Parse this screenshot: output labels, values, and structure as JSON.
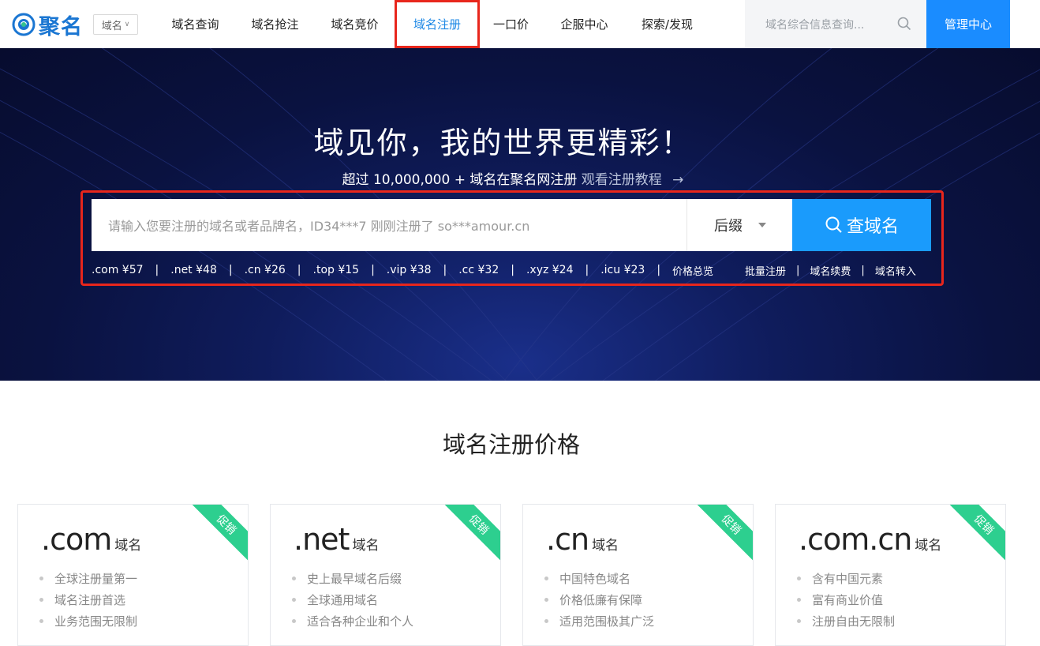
{
  "header": {
    "logo_text": "聚名",
    "category_select": "域名",
    "nav": [
      {
        "label": "域名查询"
      },
      {
        "label": "域名抢注"
      },
      {
        "label": "域名竞价"
      },
      {
        "label": "域名注册"
      },
      {
        "label": "一口价"
      },
      {
        "label": "企服中心"
      },
      {
        "label": "探索/发现"
      }
    ],
    "search_placeholder": "域名综合信息查询...",
    "admin_button": "管理中心",
    "colors": {
      "brand": "#1a76d2",
      "accent": "#1a8cff",
      "highlight": "#e8261c"
    }
  },
  "hero": {
    "title": "域见你，我的世界更精彩！",
    "subtitle_main": "超过 10,000,000 + 域名在聚名网注册",
    "subtitle_link": "观看注册教程",
    "subtitle_arrow": "→",
    "search": {
      "placeholder": "请输入您要注册的域名或者品牌名，ID34***7 刚刚注册了 so***amour.cn",
      "suffix_label": "后缀",
      "button_label": "查域名"
    },
    "prices": [
      {
        "text": ".com ¥57"
      },
      {
        "text": ".net ¥48"
      },
      {
        "text": ".cn ¥26"
      },
      {
        "text": ".top ¥15"
      },
      {
        "text": ".vip ¥38"
      },
      {
        "text": ".cc ¥32"
      },
      {
        "text": ".xyz ¥24"
      },
      {
        "text": ".icu ¥23"
      },
      {
        "text": "价格总览"
      }
    ],
    "right_links": [
      {
        "text": "批量注册"
      },
      {
        "text": "域名续费"
      },
      {
        "text": "域名转入"
      }
    ]
  },
  "pricing": {
    "title": "域名注册价格",
    "cards": [
      {
        "tld": ".com",
        "suffix": "域名",
        "badge": "促销",
        "features": [
          "全球注册量第一",
          "域名注册首选",
          "业务范围无限制"
        ]
      },
      {
        "tld": ".net",
        "suffix": "域名",
        "badge": "促销",
        "features": [
          "史上最早域名后缀",
          "全球通用域名",
          "适合各种企业和个人"
        ]
      },
      {
        "tld": ".cn",
        "suffix": "域名",
        "badge": "促销",
        "features": [
          "中国特色域名",
          "价格低廉有保障",
          "适用范围极其广泛"
        ]
      },
      {
        "tld": ".com.cn",
        "suffix": "域名",
        "badge": "促销",
        "features": [
          "含有中国元素",
          "富有商业价值",
          "注册自由无限制"
        ]
      }
    ]
  }
}
